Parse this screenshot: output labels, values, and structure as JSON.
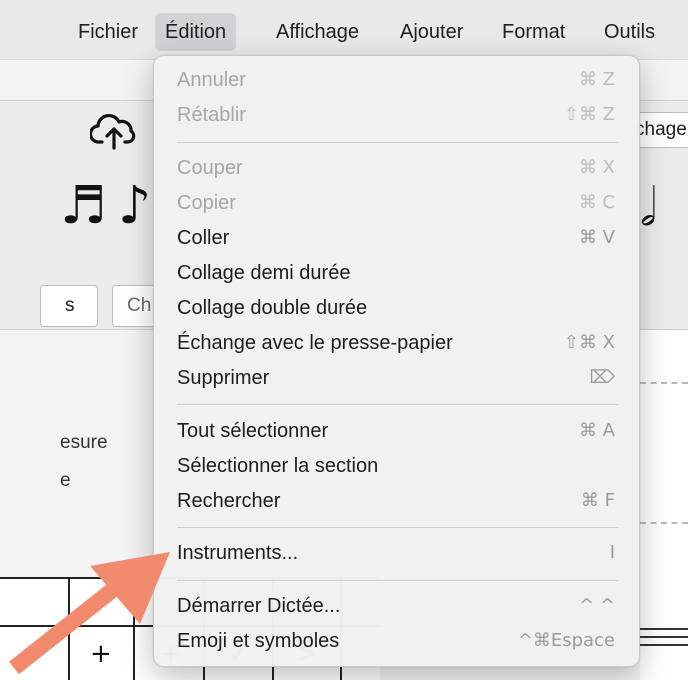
{
  "menubar": {
    "items": [
      {
        "label": "Fichier"
      },
      {
        "label": "Édition"
      },
      {
        "label": "Affichage"
      },
      {
        "label": "Ajouter"
      },
      {
        "label": "Format"
      },
      {
        "label": "Outils"
      }
    ],
    "active": "Édition"
  },
  "background": {
    "partage_label": "chage",
    "filter_label": "s",
    "search_placeholder": "Ch",
    "side_labels": [
      "esure",
      "e"
    ],
    "icons": [
      "cloud-upload-icon",
      "sixteenth-note-icon",
      "half-note-icon"
    ]
  },
  "edit_menu": {
    "items": [
      {
        "label": "Annuler",
        "shortcut": "⌘ Z",
        "enabled": false
      },
      {
        "label": "Rétablir",
        "shortcut": "⇧⌘ Z",
        "enabled": false
      },
      {
        "label": "Couper",
        "shortcut": "⌘ X",
        "enabled": false
      },
      {
        "label": "Copier",
        "shortcut": "⌘ C",
        "enabled": false
      },
      {
        "label": "Coller",
        "shortcut": "⌘ V",
        "enabled": true
      },
      {
        "label": "Collage demi durée",
        "shortcut": "",
        "enabled": true
      },
      {
        "label": "Collage double durée",
        "shortcut": "",
        "enabled": true
      },
      {
        "label": "Échange avec le presse-papier",
        "shortcut": "⇧⌘ X",
        "enabled": true
      },
      {
        "label": "Supprimer",
        "shortcut": "⌦",
        "enabled": true
      },
      {
        "label": "Tout sélectionner",
        "shortcut": "⌘ A",
        "enabled": true
      },
      {
        "label": "Sélectionner la section",
        "shortcut": "",
        "enabled": true
      },
      {
        "label": "Rechercher",
        "shortcut": "⌘ F",
        "enabled": true
      },
      {
        "label": "Instruments...",
        "shortcut": "I",
        "enabled": true
      },
      {
        "label": "Démarrer Dictée...",
        "shortcut": "^ ^",
        "enabled": true
      },
      {
        "label": "Emoji et symboles",
        "shortcut": "^⌘Espace",
        "enabled": true
      }
    ]
  },
  "colors": {
    "arrow": "#f28b6e",
    "menubar_bg": "#e9e9ea",
    "menu_bg": "#f1f1f1",
    "disabled_text": "#a6a6a6"
  }
}
